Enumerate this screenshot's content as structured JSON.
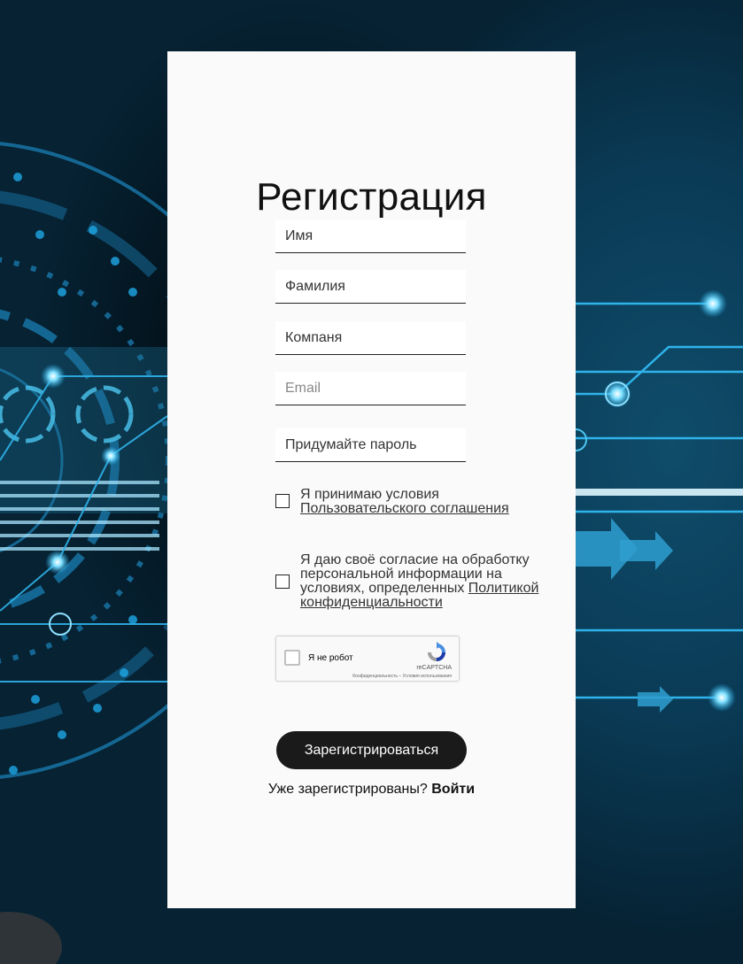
{
  "colors": {
    "card_bg": "#fafafa",
    "button_bg": "#1a1a1a",
    "button_text": "#ffffff",
    "background_accent": "#1ea7e6"
  },
  "form": {
    "title": "Регистрация",
    "fields": {
      "first_name": "Имя",
      "last_name": "Фамилия",
      "company": "Компаня",
      "email": "Email",
      "password": "Придумайте пароль"
    },
    "terms": {
      "prefix": "Я принимаю условия",
      "link": "Пользовательского соглашения"
    },
    "privacy": {
      "prefix": "Я даю своё согласие на обработку персональной информации на условиях, определенных",
      "link": "Политикой конфиденциальности"
    },
    "captcha": {
      "label": "Я не робот",
      "brand": "reCAPTCHA",
      "terms": "Конфиденциальность – Условия использования"
    },
    "submit": "Зарегистрироваться",
    "already_registered": "Уже зарегистрированы?",
    "login": "Войти"
  }
}
